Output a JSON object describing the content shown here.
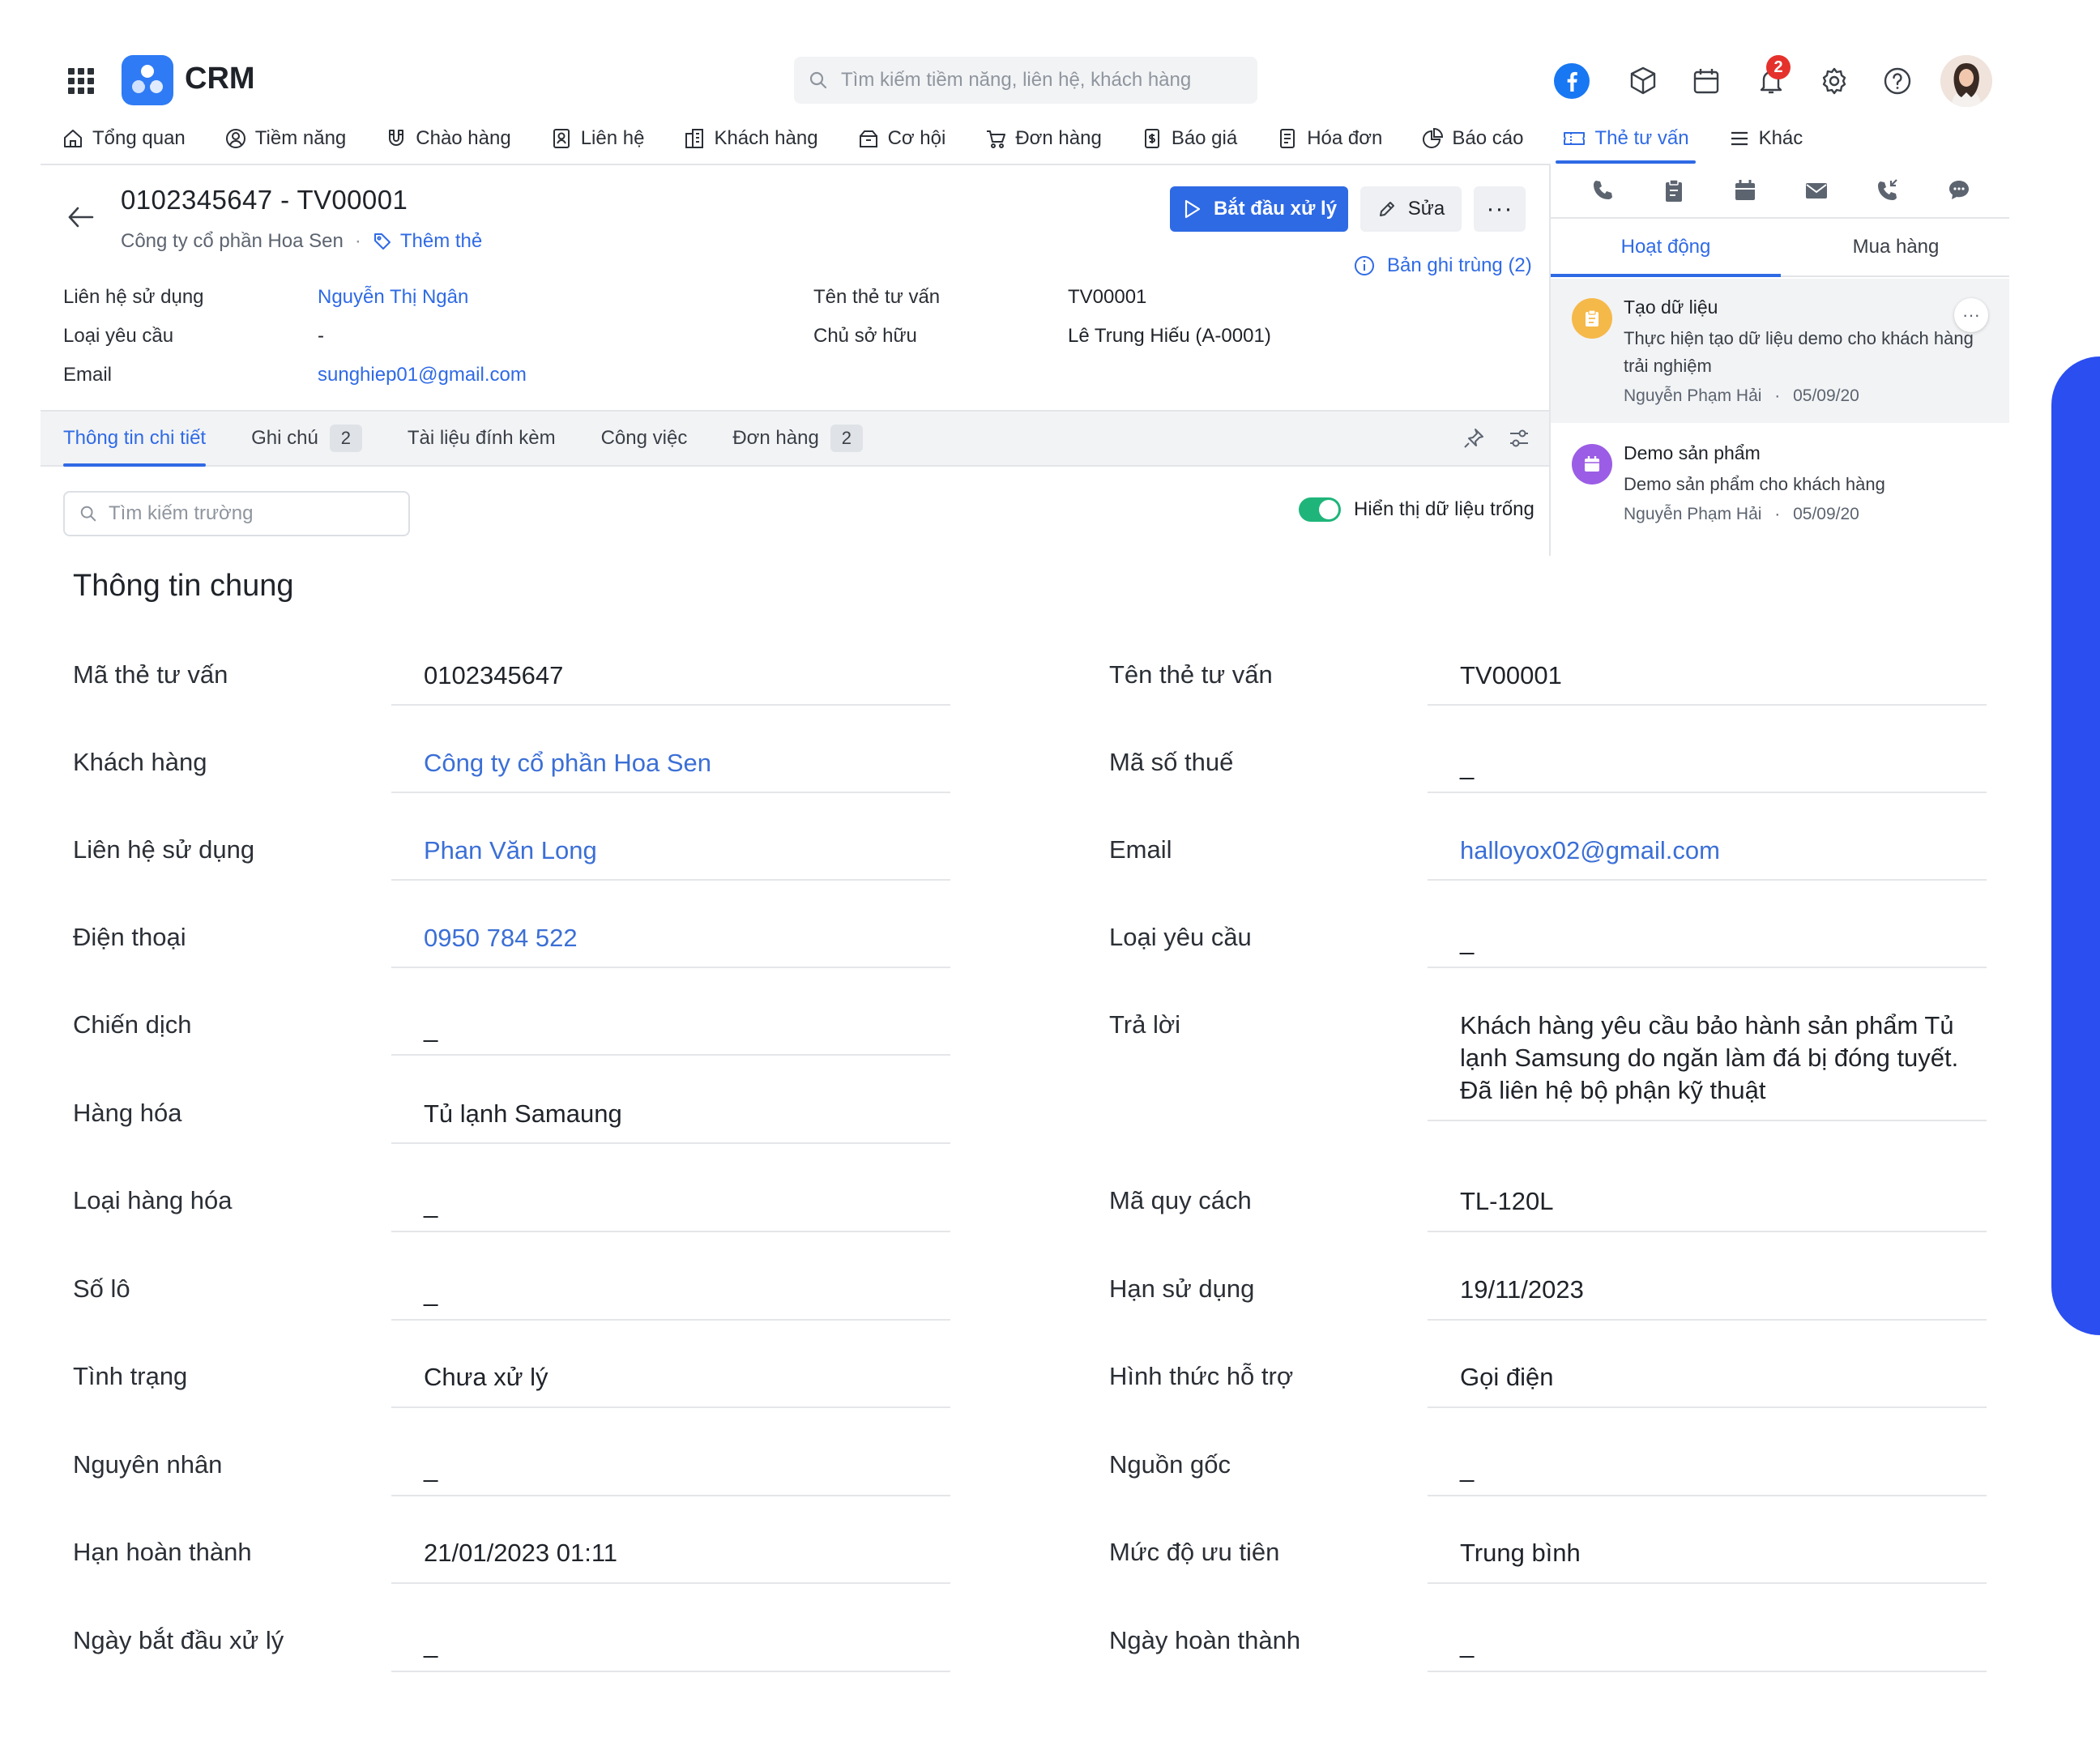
{
  "app": {
    "name": "CRM",
    "search_placeholder": "Tìm kiếm tiềm năng, liên hệ, khách hàng",
    "notification_count": "2"
  },
  "nav": [
    {
      "label": "Tổng quan",
      "icon": "home-icon"
    },
    {
      "label": "Tiềm năng",
      "icon": "person-icon"
    },
    {
      "label": "Chào hàng",
      "icon": "magnet-icon"
    },
    {
      "label": "Liên hệ",
      "icon": "contact-icon"
    },
    {
      "label": "Khách hàng",
      "icon": "building-icon"
    },
    {
      "label": "Cơ hội",
      "icon": "briefcase-icon"
    },
    {
      "label": "Đơn hàng",
      "icon": "cart-icon"
    },
    {
      "label": "Báo giá",
      "icon": "quote-icon"
    },
    {
      "label": "Hóa đơn",
      "icon": "invoice-icon"
    },
    {
      "label": "Báo cáo",
      "icon": "pie-chart-icon"
    },
    {
      "label": "Thẻ tư vấn",
      "icon": "ticket-icon",
      "active": true
    },
    {
      "label": "Khác",
      "icon": "menu-icon"
    }
  ],
  "record": {
    "title": "0102345647 - TV00001",
    "company": "Công ty cổ phần Hoa Sen",
    "add_tag": "Thêm thẻ",
    "start_button": "Bắt đầu xử lý",
    "edit_button": "Sửa",
    "more_button": "···",
    "duplicates": "Bản ghi trùng (2)",
    "summary": {
      "contact_label": "Liên hệ sử dụng",
      "contact_value": "Nguyễn Thị Ngân",
      "request_type_label": "Loại yêu cầu",
      "request_type_value": "-",
      "email_label": "Email",
      "email_value": "sunghiep01@gmail.com",
      "ticket_name_label": "Tên thẻ tư vấn",
      "ticket_name_value": "TV00001",
      "owner_label": "Chủ sở hữu",
      "owner_value": "Lê Trung Hiếu (A-0001)"
    }
  },
  "detail_tabs": [
    {
      "label": "Thông tin chi tiết",
      "count": "",
      "active": true
    },
    {
      "label": "Ghi chú",
      "count": "2"
    },
    {
      "label": "Tài liệu đính kèm",
      "count": ""
    },
    {
      "label": "Công việc",
      "count": ""
    },
    {
      "label": "Đơn hàng",
      "count": "2"
    }
  ],
  "field_search_placeholder": "Tìm kiếm trường",
  "show_empty_label": "Hiển thị dữ liệu trống",
  "panel": {
    "tabs": [
      {
        "label": "Hoạt động",
        "active": true
      },
      {
        "label": "Mua hàng"
      }
    ],
    "activities": [
      {
        "title": "Tạo dữ liệu",
        "desc": "Thực hiện tạo dữ liệu demo cho khách hàng trải nghiệm",
        "author": "Nguyễn Phạm Hải",
        "date": "05/09/20",
        "color": "#f5b94a"
      },
      {
        "title": "Demo sản phẩm",
        "desc": "Demo sản phẩm cho khách hàng",
        "author": "Nguyễn Phạm Hải",
        "date": "05/09/20",
        "color": "#9b5de5"
      }
    ],
    "meta_separator": "·",
    "more_label": "···"
  },
  "section": {
    "title": "Thông tin chung",
    "left": [
      {
        "label": "Mã thẻ tư vấn",
        "value": "0102345647"
      },
      {
        "label": "Khách hàng",
        "value": "Công ty cổ phần Hoa Sen",
        "link": true
      },
      {
        "label": "Liên hệ sử dụng",
        "value": "Phan Văn Long",
        "link": true
      },
      {
        "label": "Điện thoại",
        "value": "0950 784 522",
        "link": true
      },
      {
        "label": "Chiến dịch",
        "value": "_"
      },
      {
        "label": "Hàng hóa",
        "value": "Tủ lạnh Samaung"
      },
      {
        "label": "Loại hàng hóa",
        "value": "_"
      },
      {
        "label": "Số lô",
        "value": "_"
      },
      {
        "label": "Tình trạng",
        "value": "Chưa xử lý"
      },
      {
        "label": "Nguyên nhân",
        "value": "_"
      },
      {
        "label": "Hạn hoàn thành",
        "value": "21/01/2023 01:11"
      },
      {
        "label": "Ngày bắt đầu xử lý",
        "value": "_"
      }
    ],
    "right": [
      {
        "label": "Tên thẻ tư vấn",
        "value": "TV00001"
      },
      {
        "label": "Mã số thuế",
        "value": "_"
      },
      {
        "label": "Email",
        "value": "halloyox02@gmail.com",
        "link": true
      },
      {
        "label": "Loại yêu cầu",
        "value": "_"
      },
      {
        "label": "Trả lời",
        "value": "Khách hàng yêu cầu bảo hành sản phẩm Tủ lạnh Samsung do ngăn làm đá bị đóng tuyết. Đã liên hệ bộ phận kỹ thuật",
        "tall": true
      },
      {
        "label": "Mã quy cách",
        "value": "TL-120L"
      },
      {
        "label": "Hạn sử dụng",
        "value": "19/11/2023"
      },
      {
        "label": "Hình thức hỗ trợ",
        "value": "Gọi điện"
      },
      {
        "label": "Nguồn gốc",
        "value": "_"
      },
      {
        "label": "Mức độ ưu tiên",
        "value": "Trung bình"
      },
      {
        "label": "Ngày hoàn thành",
        "value": "_"
      }
    ]
  }
}
